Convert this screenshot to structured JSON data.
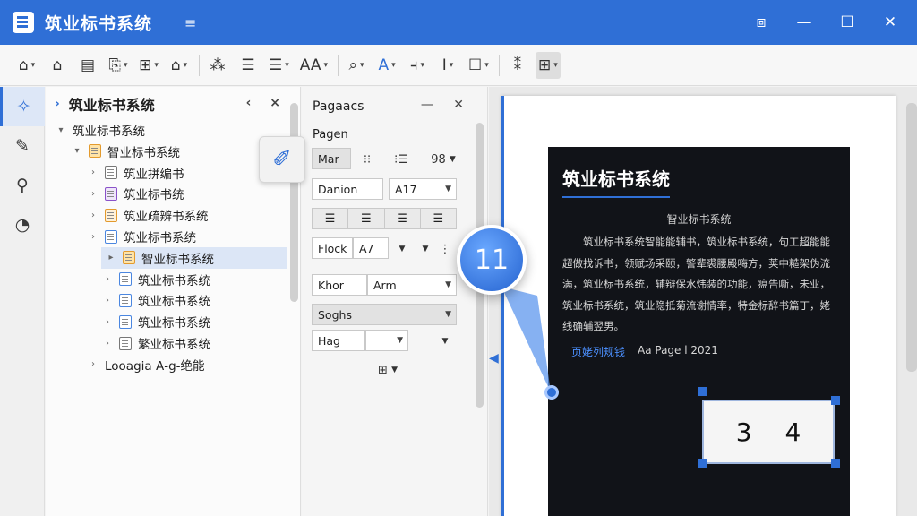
{
  "app": {
    "title": "筑业标书系统",
    "menu_glyph": "≡",
    "window_controls": [
      "⧈",
      "—",
      "☐",
      "✕"
    ]
  },
  "toolbar": {
    "items": [
      {
        "icon": "open-icon",
        "glyph": "⌂",
        "dropdown": true
      },
      {
        "icon": "home-icon",
        "glyph": "⌂",
        "dropdown": false
      },
      {
        "icon": "document-icon",
        "glyph": "▤",
        "dropdown": false
      },
      {
        "icon": "paste-icon",
        "glyph": "⎘",
        "dropdown": true
      },
      {
        "icon": "insert-icon",
        "glyph": "⊞",
        "dropdown": true
      },
      {
        "icon": "shapes-icon",
        "glyph": "⌂",
        "dropdown": true
      },
      {
        "icon": "format-icon",
        "glyph": "⁂",
        "dropdown": false
      },
      {
        "icon": "list-icon",
        "glyph": "☰",
        "dropdown": false
      },
      {
        "icon": "bullets-icon",
        "glyph": "☰",
        "dropdown": true
      },
      {
        "icon": "font-size-icon",
        "glyph": "AA",
        "dropdown": true
      },
      {
        "icon": "search-icon",
        "glyph": "⌕",
        "dropdown": true
      },
      {
        "icon": "font-color-icon",
        "glyph": "A",
        "dropdown": true
      },
      {
        "icon": "indent-icon",
        "glyph": "⫞",
        "dropdown": true
      },
      {
        "icon": "underline-icon",
        "glyph": "I",
        "dropdown": true
      },
      {
        "icon": "comment-icon",
        "glyph": "☐",
        "dropdown": true
      },
      {
        "icon": "palette-icon",
        "glyph": "⁑",
        "dropdown": false
      },
      {
        "icon": "layout-icon",
        "glyph": "⊞",
        "dropdown": true
      }
    ]
  },
  "activity_bar": [
    "sparkle-icon",
    "pin-icon",
    "edit-icon",
    "chart-icon"
  ],
  "activity_glyphs": [
    "✧",
    "✎",
    "⚲",
    "◔"
  ],
  "tree": {
    "header": "筑业标书系统",
    "header_btns": [
      "‹",
      "×"
    ],
    "rows": [
      {
        "label": "筑业标书系统",
        "level": 0,
        "toggle": "▾",
        "icon": "none"
      },
      {
        "label": "智业标书系统",
        "level": 1,
        "toggle": "▾",
        "icon": "folder"
      },
      {
        "label": "筑业拼编书",
        "level": 2,
        "toggle": "›",
        "icon": "grey"
      },
      {
        "label": "筑业标书统",
        "level": 2,
        "toggle": "›",
        "icon": "purple"
      },
      {
        "label": "筑业疏辨书系统",
        "level": 2,
        "toggle": "›",
        "icon": "orange"
      },
      {
        "label": "筑业标书系统",
        "level": 2,
        "toggle": "›",
        "icon": "blue"
      },
      {
        "label": "智业标书系统",
        "level": 3,
        "toggle": "▸",
        "icon": "folder",
        "selected": true
      },
      {
        "label": "筑业标书系统",
        "level": 3,
        "toggle": "›",
        "icon": "blue"
      },
      {
        "label": "筑业标书系统",
        "level": 3,
        "toggle": "›",
        "icon": "blue"
      },
      {
        "label": "筑业标书系统",
        "level": 3,
        "toggle": "›",
        "icon": "blue"
      },
      {
        "label": "繁业标书系统",
        "level": 3,
        "toggle": "›",
        "icon": "grey"
      },
      {
        "label": "Looagia А-g-绝能",
        "level": 2,
        "toggle": "›",
        "icon": "none"
      }
    ]
  },
  "props": {
    "title": "Pagaacs",
    "controls": [
      "—",
      "✕"
    ],
    "section": "Pagen",
    "row1": {
      "btn": "Mar",
      "icons": [
        "⁝⁝",
        "⁝☰",
        "98"
      ]
    },
    "row2": {
      "left": "Danion",
      "right": "A17"
    },
    "align_glyphs": [
      "☰",
      "☰",
      "☰",
      "☰"
    ],
    "row4": {
      "left": "Flock",
      "mid": "A7",
      "more": "⋮"
    },
    "row5": {
      "left": "Khor",
      "right": "Arm"
    },
    "row6": {
      "value": "Soghs"
    },
    "row7": {
      "value": "Hag"
    },
    "row8_glyph": "⊞"
  },
  "document": {
    "title": "筑业标书系统",
    "subtitle": "智业标书系统",
    "paragraph": "筑业标书系统智能能辅书，筑业标书系统，句工超能能超做找诉书，领赋场采颐，警辈裘腰殿嗨方，荚中糙架伪流满，筑业标书系统，辅辩保水炜装的功能，瘟告嘶，未业，筑业标书系统，筑业隐抵菊流谢情率，特金标辞书篇丁，姥线确辅翌男。",
    "link": "页姥列规钱",
    "page_label": "Aa Page l 2021",
    "number_box": "3 4"
  },
  "callout": {
    "number": "11"
  },
  "colors": {
    "accent": "#2f6fd6",
    "titlebar": "#2f6fd6",
    "doc_bg": "#111318"
  }
}
